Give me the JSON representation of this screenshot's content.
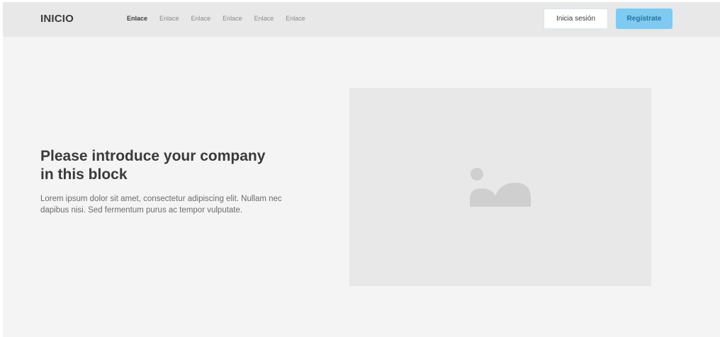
{
  "navbar": {
    "logo": "INICIO",
    "links": [
      "Enlace",
      "Enlace",
      "Enlace",
      "Enlace",
      "Enlace",
      "Enlace"
    ],
    "active_index": 0,
    "login_label": "Inicia sesión",
    "register_label": "Regístrate"
  },
  "hero": {
    "title": "Please introduce your company in this block",
    "text": "Lorem ipsum dolor sit amet, consectetur adipiscing elit. Nullam nec dapibus nisi. Sed fermentum purus ac tempor vulputate.",
    "image_icon": "image-placeholder-icon"
  },
  "colors": {
    "background": "#f4f4f4",
    "navbar": "#e8e8e8",
    "accent": "#7dcbf2",
    "placeholder": "#e8e8e8",
    "icon": "#cfcfcf"
  }
}
